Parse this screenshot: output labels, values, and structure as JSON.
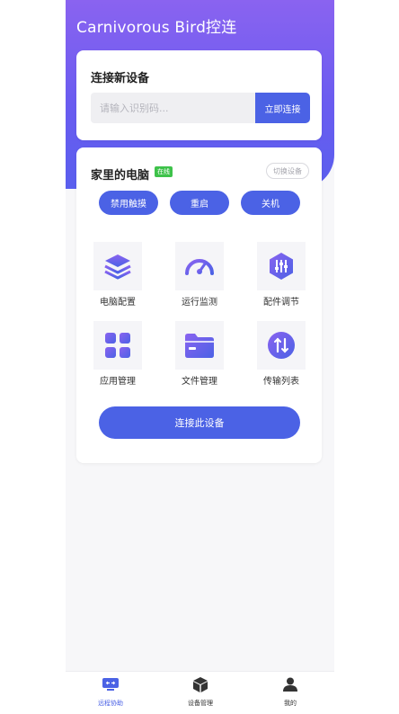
{
  "app": {
    "title": "Carnivorous Bird控连"
  },
  "new_device": {
    "title": "连接新设备",
    "input_placeholder": "请输入识别码...",
    "connect_label": "立即连接"
  },
  "device": {
    "name": "家里的电脑",
    "status": "在线",
    "switch_label": "切换设备",
    "actions": [
      "禁用触摸",
      "重启",
      "关机"
    ],
    "features": [
      {
        "label": "电脑配置",
        "icon": "layers-icon"
      },
      {
        "label": "运行监测",
        "icon": "speedometer-icon"
      },
      {
        "label": "配件调节",
        "icon": "sliders-icon"
      },
      {
        "label": "应用管理",
        "icon": "grid-icon"
      },
      {
        "label": "文件管理",
        "icon": "folder-icon"
      },
      {
        "label": "传输列表",
        "icon": "transfer-icon"
      }
    ],
    "connect_label": "连接此设备"
  },
  "tabs": [
    {
      "label": "远程协助",
      "icon": "remote-icon",
      "active": true
    },
    {
      "label": "设备管理",
      "icon": "cube-icon",
      "active": false
    },
    {
      "label": "我的",
      "icon": "user-icon",
      "active": false
    }
  ],
  "colors": {
    "primary": "#4b62e5",
    "gradient_top": "#8a63f0",
    "online": "#3ec24a"
  }
}
